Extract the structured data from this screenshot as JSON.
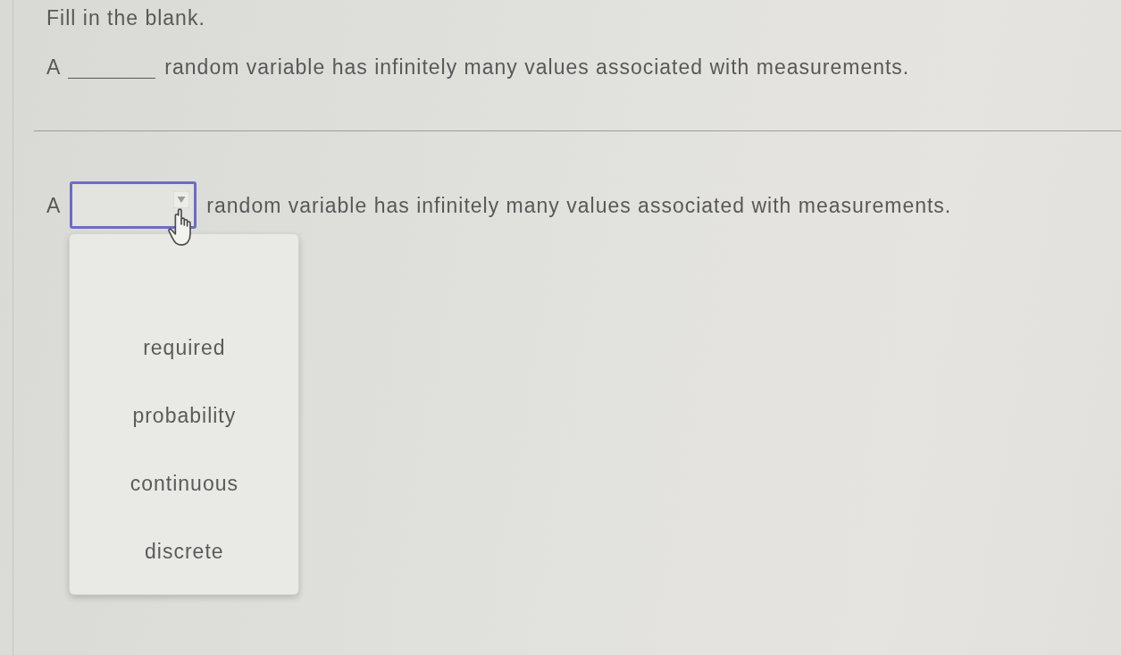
{
  "instruction": "Fill in the blank.",
  "question": {
    "before": "A",
    "after": "random variable has infinitely many values associated with measurements."
  },
  "answer": {
    "before": "A",
    "after": "random variable has infinitely many values associated with measurements.",
    "dropdown": {
      "expanded": true,
      "options": [
        {
          "label": "required",
          "selected": false
        },
        {
          "label": "probability",
          "selected": false
        },
        {
          "label": "continuous",
          "selected": false
        },
        {
          "label": "discrete",
          "selected": false
        }
      ]
    }
  }
}
